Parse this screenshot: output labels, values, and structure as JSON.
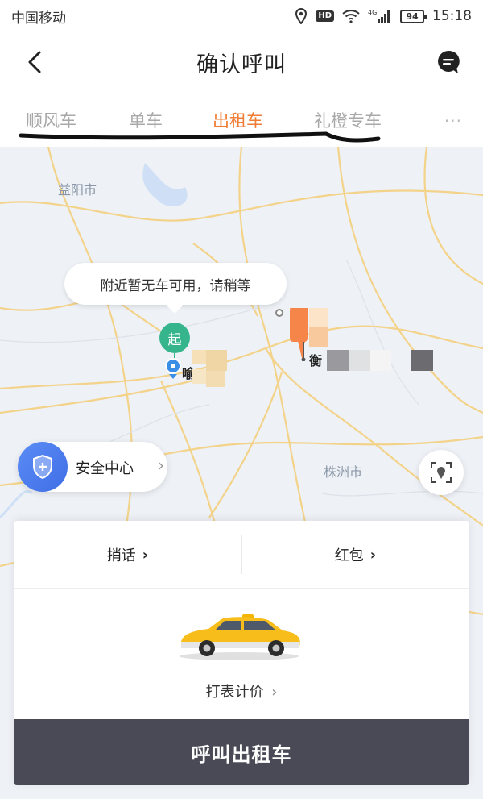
{
  "status_bar": {
    "carrier": "中国移动",
    "network": "4G",
    "battery": "94",
    "time": "15:18"
  },
  "header": {
    "title": "确认呼叫"
  },
  "tabs": [
    {
      "label": "顺风车",
      "active": false
    },
    {
      "label": "单车",
      "active": false
    },
    {
      "label": "出租车",
      "active": true
    },
    {
      "label": "礼橙专车",
      "active": false
    }
  ],
  "tabs_more": "···",
  "map": {
    "cities": [
      "益阳市",
      "株洲市"
    ],
    "notice": "附近暂无车可用，请稍等",
    "start_badge": "起",
    "start_name_fragment": "喻",
    "end_name_fragment": "衡",
    "safety_center": "安全中心"
  },
  "card": {
    "message_option": "捎话",
    "red_packet_option": "红包",
    "fare_mode": "打表计价",
    "call_button": "呼叫出租车"
  },
  "colors": {
    "accent": "#f07c33",
    "start_green": "#36b58d",
    "call_button_bg": "#4a4a56",
    "safety_blue": "#4a7cf0"
  }
}
